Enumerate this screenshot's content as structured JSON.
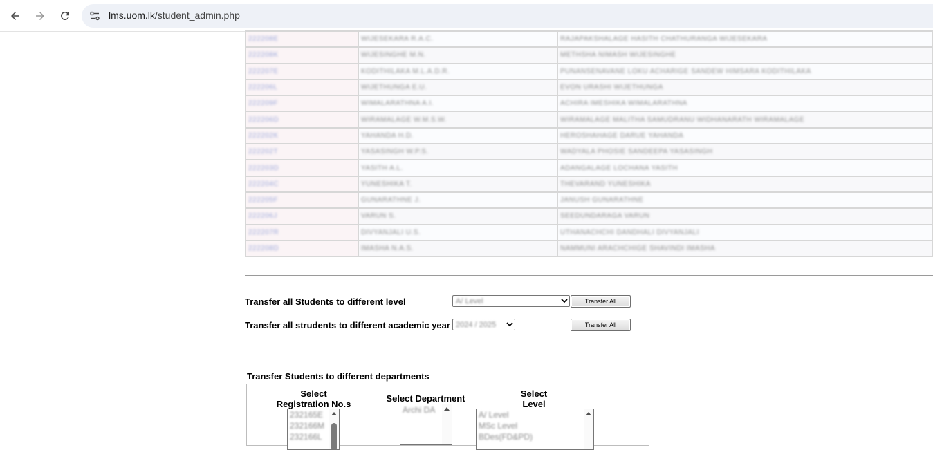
{
  "browser": {
    "url_host": "lms.uom.lk",
    "url_path": "/student_admin.php"
  },
  "students": [
    {
      "reg": "222208E",
      "initials": "WIJESEKARA R.A.C.",
      "full": "RAJAPAKSHALAGE HASITH CHATHURANGA WIJESEKARA"
    },
    {
      "reg": "222208K",
      "initials": "WIJESINGHE M.N.",
      "full": "METHSHA NIMASH WIJESINGHE"
    },
    {
      "reg": "222207E",
      "initials": "KODITHILAKA M.L.A.D.R.",
      "full": "PUNANSENAVANE LOKU ACHARIGE SANDEW HIMSARA KODITHILAKA"
    },
    {
      "reg": "222206L",
      "initials": "WIJETHUNGA E.U.",
      "full": "EVON URASHI WIJETHUNGA"
    },
    {
      "reg": "222209F",
      "initials": "WIMALARATHNA A.I.",
      "full": "ACHIRA IMESHIKA WIMALARATHNA"
    },
    {
      "reg": "222206D",
      "initials": "WIRAMALAGE W.M.S.W.",
      "full": "WIRAMALAGE MALITHA SAMUDRANU WIDHANARATH WIRAMALAGE"
    },
    {
      "reg": "222202K",
      "initials": "YAHANDA H.D.",
      "full": "HEROSHAHAGE DARUE YAHANDA"
    },
    {
      "reg": "222202T",
      "initials": "YASASINGH W.P.S.",
      "full": "WADYALA PHOSIE SANDEEPA YASASINGH"
    },
    {
      "reg": "222203D",
      "initials": "YASITH A.L.",
      "full": "ADANGALAGE LOCHANA YASITH"
    },
    {
      "reg": "222204C",
      "initials": "YUNESHIKA T.",
      "full": "THEVARAND YUNESHIKA"
    },
    {
      "reg": "222205F",
      "initials": "GUNARATHNE J.",
      "full": "JANUSH GUNARATHNE"
    },
    {
      "reg": "222206J",
      "initials": "VARUN S.",
      "full": "SEEDUNDARAGA VARUN"
    },
    {
      "reg": "222207R",
      "initials": "DIVYANJALI U.S.",
      "full": "UTHANACHCHI DANDHALI DIVYANJALI"
    },
    {
      "reg": "222208D",
      "initials": "IMASHA N.A.S.",
      "full": "NAMMUNI ARACHCHIGE SHAVINDI IMASHA"
    }
  ],
  "transfer_level": {
    "label": "Transfer all Students to different level",
    "selected": "A/ Level",
    "button": "Transfer All"
  },
  "transfer_year": {
    "label": "Transfer all strudents to different academic year",
    "selected": "2024 / 2025",
    "button": "Transfer All"
  },
  "departments": {
    "heading": "Transfer Students to different departments",
    "col_reg": "Select\nRegistration No.s",
    "col_dept": "Select Department",
    "col_level": "Select\nLevel",
    "reg_options": [
      "232165E",
      "232166M",
      "232166L"
    ],
    "dept_options": [
      "Archi DA"
    ],
    "level_options": [
      "A/ Level",
      "MSc Level",
      "BDes(FD&PD)"
    ]
  },
  "icons": {
    "back": "back-arrow-icon",
    "forward": "forward-arrow-icon",
    "reload": "reload-icon",
    "site_info": "site-info-icon"
  }
}
